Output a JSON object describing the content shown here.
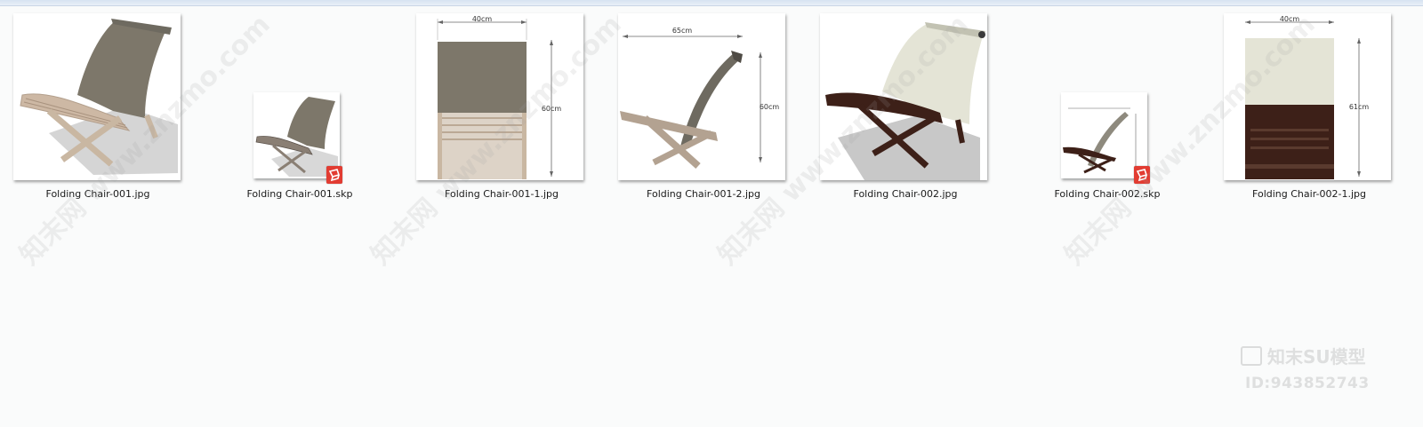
{
  "files": [
    {
      "name": "Folding Chair-001.jpg",
      "type": "jpg",
      "thumbnail": "chair-001-perspective"
    },
    {
      "name": "Folding Chair-001.skp",
      "type": "skp",
      "thumbnail": "chair-001-small"
    },
    {
      "name": "Folding Chair-001-1.jpg",
      "type": "jpg",
      "thumbnail": "chair-001-front-dimensions",
      "dims": [
        "40cm",
        "60cm"
      ]
    },
    {
      "name": "Folding Chair-001-2.jpg",
      "type": "jpg",
      "thumbnail": "chair-001-side-dimensions",
      "dims": [
        "65cm",
        "60cm"
      ]
    },
    {
      "name": "Folding Chair-002.jpg",
      "type": "jpg",
      "thumbnail": "chair-002-perspective"
    },
    {
      "name": "Folding Chair-002.skp",
      "type": "skp",
      "thumbnail": "chair-002-small"
    },
    {
      "name": "Folding Chair-002-1.jpg",
      "type": "jpg",
      "thumbnail": "chair-002-front-dimensions",
      "dims": [
        "40cm",
        "61cm"
      ]
    }
  ],
  "watermark": {
    "text": "知末网 www.znzmo.com",
    "brand": "知末SU模型",
    "id": "ID:943852743"
  },
  "colors": {
    "background": "#fafbfb",
    "skp_badge": "#e23c32",
    "fabric_taupe": "#7d776a",
    "wood_light": "#c9b7a2",
    "wood_dark": "#3d2018",
    "fabric_cream": "#e4e4d6"
  }
}
